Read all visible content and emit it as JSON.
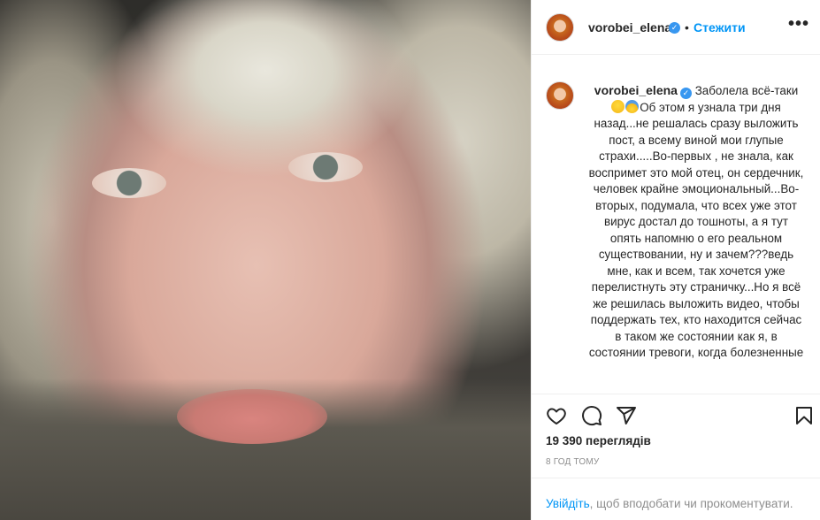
{
  "header": {
    "username": "vorobei_elena",
    "verified_glyph": "✓",
    "separator": "•",
    "follow_label": "Стежити",
    "more_label": "•••"
  },
  "caption": {
    "username": "vorobei_elena",
    "text_1": "Заболела всё-таки",
    "text_2": "Об этом я узнала три дня назад...не решалась сразу выложить пост, а всему виной мои глупые страхи.....Во-первых , не знала, как воспримет это мой отец, он сердечник, человек крайне эмоциональный...Во-вторых, подумала, что всех уже этот вирус достал до тошноты, а я тут опять напомню о его реальном существовании, ну и зачем???ведь мне, как и всем, так хочется уже перелистнуть эту страничку...Но я всё же решилась выложить видео, чтобы поддержать тех, кто находится сейчас в таком же состоянии как я, в состоянии тревоги, когда болезненные"
  },
  "icons": {
    "like": "heart-icon",
    "comment": "comment-icon",
    "share": "share-icon",
    "save": "bookmark-icon"
  },
  "stats": {
    "views": "19 390 переглядів",
    "time_ago": "8 ГОД ТОМУ"
  },
  "login_prompt": {
    "link": "Увійдіть",
    "rest": ", щоб вподобати чи прокоментувати."
  },
  "colors": {
    "accent": "#0095f6",
    "verified": "#3897f0",
    "text": "#262626",
    "muted": "#8e8e8e"
  }
}
